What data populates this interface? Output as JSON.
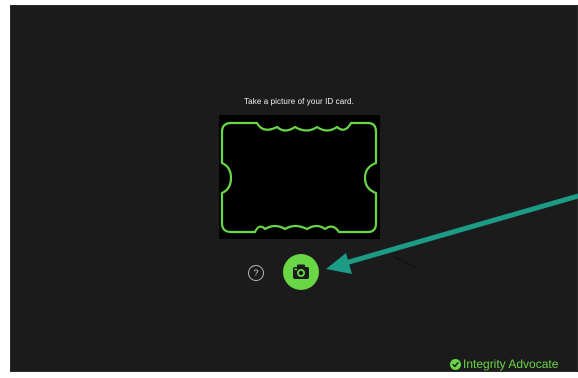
{
  "capture": {
    "instruction": "Take a picture of your ID card.",
    "help_symbol": "?",
    "help_icon": "question-circle-icon",
    "capture_icon": "camera-icon"
  },
  "brand": {
    "name": "Integrity Advocate",
    "icon": "check-circle-icon"
  },
  "colors": {
    "background": "#1b1b1b",
    "accent": "#69d646",
    "annotation_arrow": "#1c9b86"
  }
}
